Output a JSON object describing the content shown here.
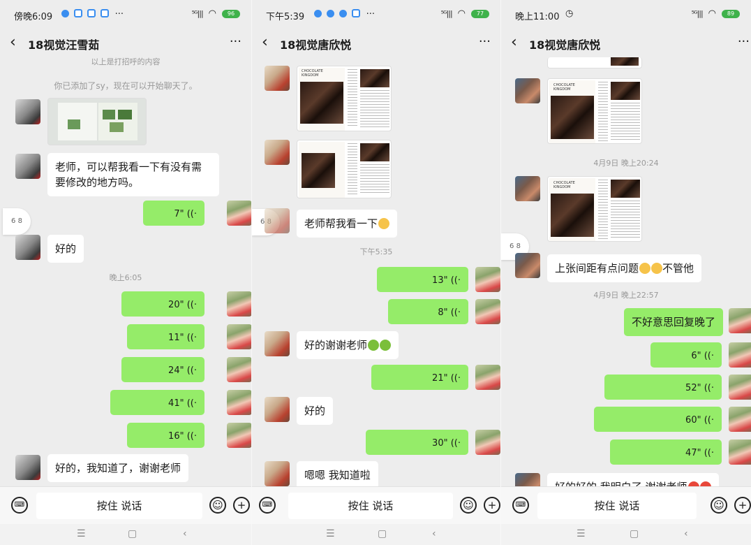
{
  "panels": [
    {
      "status_time": "傍晚6:09",
      "battery": "96",
      "contact": "18视觉汪雪茹",
      "system_notes": [
        "以上是打招呼的内容",
        "你已添加了sy，现在可以开始聊天了。"
      ],
      "time_divider": "晚上6:05",
      "texts": [
        "老师，可以帮我看一下有没有需要修改的地方吗。",
        "好的",
        "好的，我知道了，谢谢老师"
      ],
      "voices": [
        "7\"",
        "20\"",
        "11\"",
        "24\"",
        "41\"",
        "16\""
      ]
    },
    {
      "status_time": "下午5:39",
      "battery": "77",
      "contact": "18视觉唐欣悦",
      "time_divider": "下午5:35",
      "texts": [
        "老师帮我看一下",
        "好的谢谢老师",
        "好的",
        "嗯嗯 我知道啦"
      ],
      "voices": [
        "13\"",
        "8\"",
        "21\"",
        "30\""
      ],
      "image_title": "CHOCOLATE KINGDOM"
    },
    {
      "status_time": "晚上11:00",
      "battery": "89",
      "contact": "18视觉唐欣悦",
      "time_dividers": [
        "4月9日 晚上20:24",
        "4月9日 晚上22:57"
      ],
      "texts": [
        "上张间距有点问题",
        "不管他",
        "不好意思回复晚了",
        "好的好的 我明白了 谢谢老师"
      ],
      "voices": [
        "6\"",
        "52\"",
        "60\"",
        "47\""
      ],
      "image_title": "CHOCOLATE KINGDOM"
    }
  ],
  "common": {
    "back_icon": "‹",
    "more_icon": "···",
    "hold_to_talk": "按住 说话",
    "voice_icon": "((·",
    "float_tab_icon": "6 8",
    "nav_menu": "☰",
    "nav_home": "▢",
    "nav_back": "‹"
  }
}
